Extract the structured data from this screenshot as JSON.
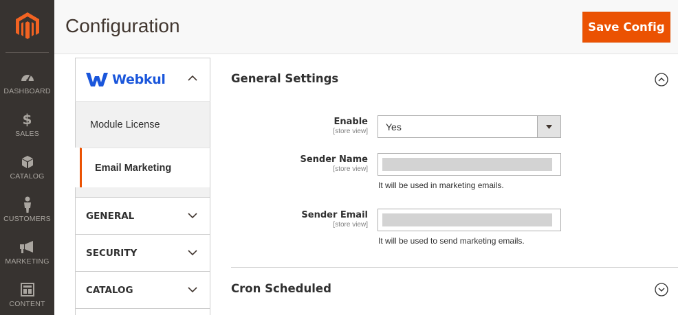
{
  "menu": {
    "items": [
      {
        "id": "dashboard",
        "label": "DASHBOARD",
        "icon": "dashboard-gauge-icon"
      },
      {
        "id": "sales",
        "label": "SALES",
        "icon": "dollar-icon"
      },
      {
        "id": "catalog",
        "label": "CATALOG",
        "icon": "cube-icon"
      },
      {
        "id": "customers",
        "label": "CUSTOMERS",
        "icon": "person-icon"
      },
      {
        "id": "marketing",
        "label": "MARKETING",
        "icon": "megaphone-icon"
      },
      {
        "id": "content",
        "label": "CONTENT",
        "icon": "layout-icon"
      }
    ]
  },
  "header": {
    "title": "Configuration",
    "save_label": "Save Config"
  },
  "sidebar": {
    "brand": "Webkul",
    "sub_items": [
      {
        "label": "Module License",
        "active": false
      },
      {
        "label": "Email Marketing",
        "active": true
      }
    ],
    "sections": [
      {
        "label": "GENERAL"
      },
      {
        "label": "SECURITY"
      },
      {
        "label": "CATALOG"
      }
    ]
  },
  "main": {
    "general": {
      "title": "General Settings",
      "enable": {
        "label": "Enable",
        "scope": "[store view]",
        "value": "Yes"
      },
      "sender_name": {
        "label": "Sender Name",
        "scope": "[store view]",
        "note": "It will be used in marketing emails."
      },
      "sender_email": {
        "label": "Sender Email",
        "scope": "[store view]",
        "note": "It will be used to send marketing emails."
      }
    },
    "cron": {
      "title": "Cron Scheduled"
    }
  },
  "colors": {
    "accent": "#eb5202",
    "menu_bg": "#373330",
    "brand_blue": "#1a56db"
  }
}
